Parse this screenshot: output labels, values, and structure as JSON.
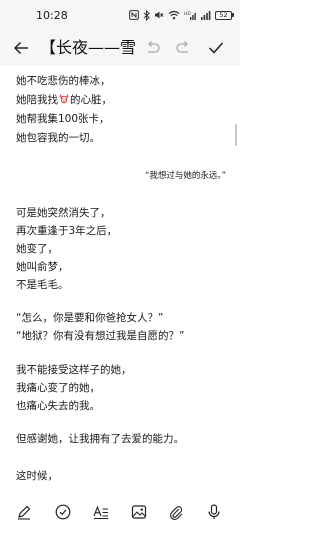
{
  "status_bar": {
    "time": "10:28",
    "battery": "52",
    "icons": [
      "nfc-icon",
      "bluetooth-icon",
      "mute-icon",
      "wifi-icon",
      "hd-signal-icon",
      "signal-icon",
      "battery-icon"
    ]
  },
  "toolbar": {
    "title": "【长夜——雪",
    "icons": [
      "back-arrow-icon",
      "undo-icon",
      "redo-icon",
      "check-icon"
    ]
  },
  "note": {
    "lines": [
      "她不吃悲伤的棒冰，",
      "她陪我找",
      "的心脏，",
      "她帮我集100张卡，",
      "她包容我的一切。",
      "“我想过与她的永远。”",
      "可是她突然消失了，",
      "再次重逢于3年之后，",
      "她变了，",
      "她叫俞梦，",
      "不是毛毛。",
      "“怎么，你是要和你爸抢女人？”",
      "“地狱？你有没有想过我是自愿的？”",
      "我不能接受这样子的她，",
      "我痛心变了的她，",
      "也痛心失去的我。",
      "但感谢她，让我拥有了去爱的能力。",
      "这时候，"
    ],
    "inline_emoji": "beast-face-emoji"
  },
  "bottom_bar": {
    "icons": [
      "pen-icon",
      "checklist-icon",
      "text-format-icon",
      "image-icon",
      "attachment-icon",
      "microphone-icon"
    ]
  },
  "colors": {
    "background": "#ffffff",
    "bars": "#f6f6f6",
    "text": "#1a1a1a",
    "emoji_red": "#e23b3b"
  }
}
